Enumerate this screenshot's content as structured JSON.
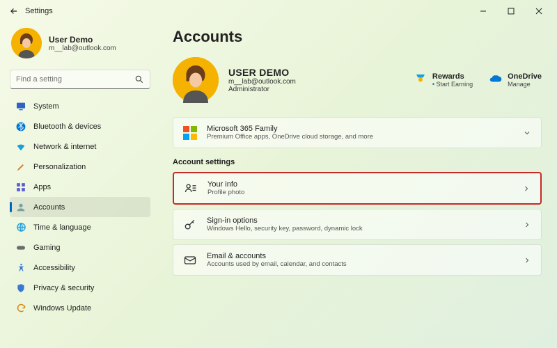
{
  "titlebar": {
    "title": "Settings"
  },
  "sidebar": {
    "user": {
      "name": "User Demo",
      "email": "m__lab@outlook.com"
    },
    "search_placeholder": "Find a setting",
    "items": [
      {
        "label": "System"
      },
      {
        "label": "Bluetooth & devices"
      },
      {
        "label": "Network & internet"
      },
      {
        "label": "Personalization"
      },
      {
        "label": "Apps"
      },
      {
        "label": "Accounts"
      },
      {
        "label": "Time & language"
      },
      {
        "label": "Gaming"
      },
      {
        "label": "Accessibility"
      },
      {
        "label": "Privacy & security"
      },
      {
        "label": "Windows Update"
      }
    ]
  },
  "main": {
    "heading": "Accounts",
    "account": {
      "name": "USER DEMO",
      "email": "m__lab@outlook.com",
      "role": "Administrator"
    },
    "tiles": {
      "rewards": {
        "title": "Rewards",
        "sub": "Start Earning"
      },
      "onedrive": {
        "title": "OneDrive",
        "sub": "Manage"
      }
    },
    "m365": {
      "title": "Microsoft 365 Family",
      "sub": "Premium Office apps, OneDrive cloud storage, and more"
    },
    "section_heading": "Account settings",
    "cards": [
      {
        "title": "Your info",
        "sub": "Profile photo"
      },
      {
        "title": "Sign-in options",
        "sub": "Windows Hello, security key, password, dynamic lock"
      },
      {
        "title": "Email & accounts",
        "sub": "Accounts used by email, calendar, and contacts"
      }
    ]
  }
}
